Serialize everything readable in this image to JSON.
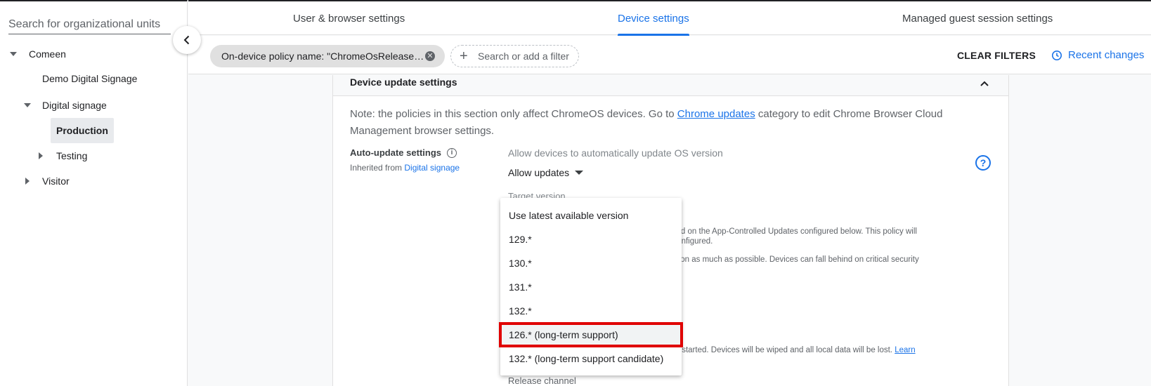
{
  "sidebar": {
    "search_placeholder": "Search for organizational units",
    "tree": [
      {
        "label": "Comeen"
      },
      {
        "label": "Demo Digital Signage"
      },
      {
        "label": "Digital signage"
      },
      {
        "label": "Production"
      },
      {
        "label": "Testing"
      },
      {
        "label": "Visitor"
      }
    ]
  },
  "tabs": [
    {
      "label": "User & browser settings"
    },
    {
      "label": "Device settings"
    },
    {
      "label": "Managed guest session settings"
    }
  ],
  "filters": {
    "chip_label": "On-device policy name: \"ChromeOsRelease…",
    "add_placeholder": "Search or add a filter",
    "clear_label": "CLEAR FILTERS",
    "recent_label": "Recent changes"
  },
  "section": {
    "title": "Device update settings",
    "note_prefix": "Note: the policies in this section only affect ChromeOS devices. Go to ",
    "note_link": "Chrome updates",
    "note_suffix": " category to edit Chrome Browser Cloud Management browser settings.",
    "setting_name": "Auto-update settings",
    "inherited_prefix": "Inherited from ",
    "inherited_link": "Digital signage",
    "allow_label": "Allow devices to automatically update OS version",
    "allow_value": "Allow updates",
    "target_label": "Target version",
    "bg_line1": "based on the App-Controlled Updates configured below. This policy will",
    "bg_line2": "re configured.",
    "bg_line3": "version as much as possible. Devices can fall behind on critical security",
    "bg_line4": "be restarted. Devices will be wiped and all local data will be lost.",
    "bg_learn": "Learn",
    "release_label": "Release channel"
  },
  "dropdown": {
    "options": [
      {
        "label": "Use latest available version"
      },
      {
        "label": "129.*"
      },
      {
        "label": "130.*"
      },
      {
        "label": "131.*"
      },
      {
        "label": "132.*"
      },
      {
        "label": "126.* (long-term support)"
      },
      {
        "label": "132.* (long-term support candidate)"
      }
    ],
    "highlighted_index": 5
  },
  "colors": {
    "accent": "#1a73e8",
    "highlight_border": "#e00000"
  }
}
